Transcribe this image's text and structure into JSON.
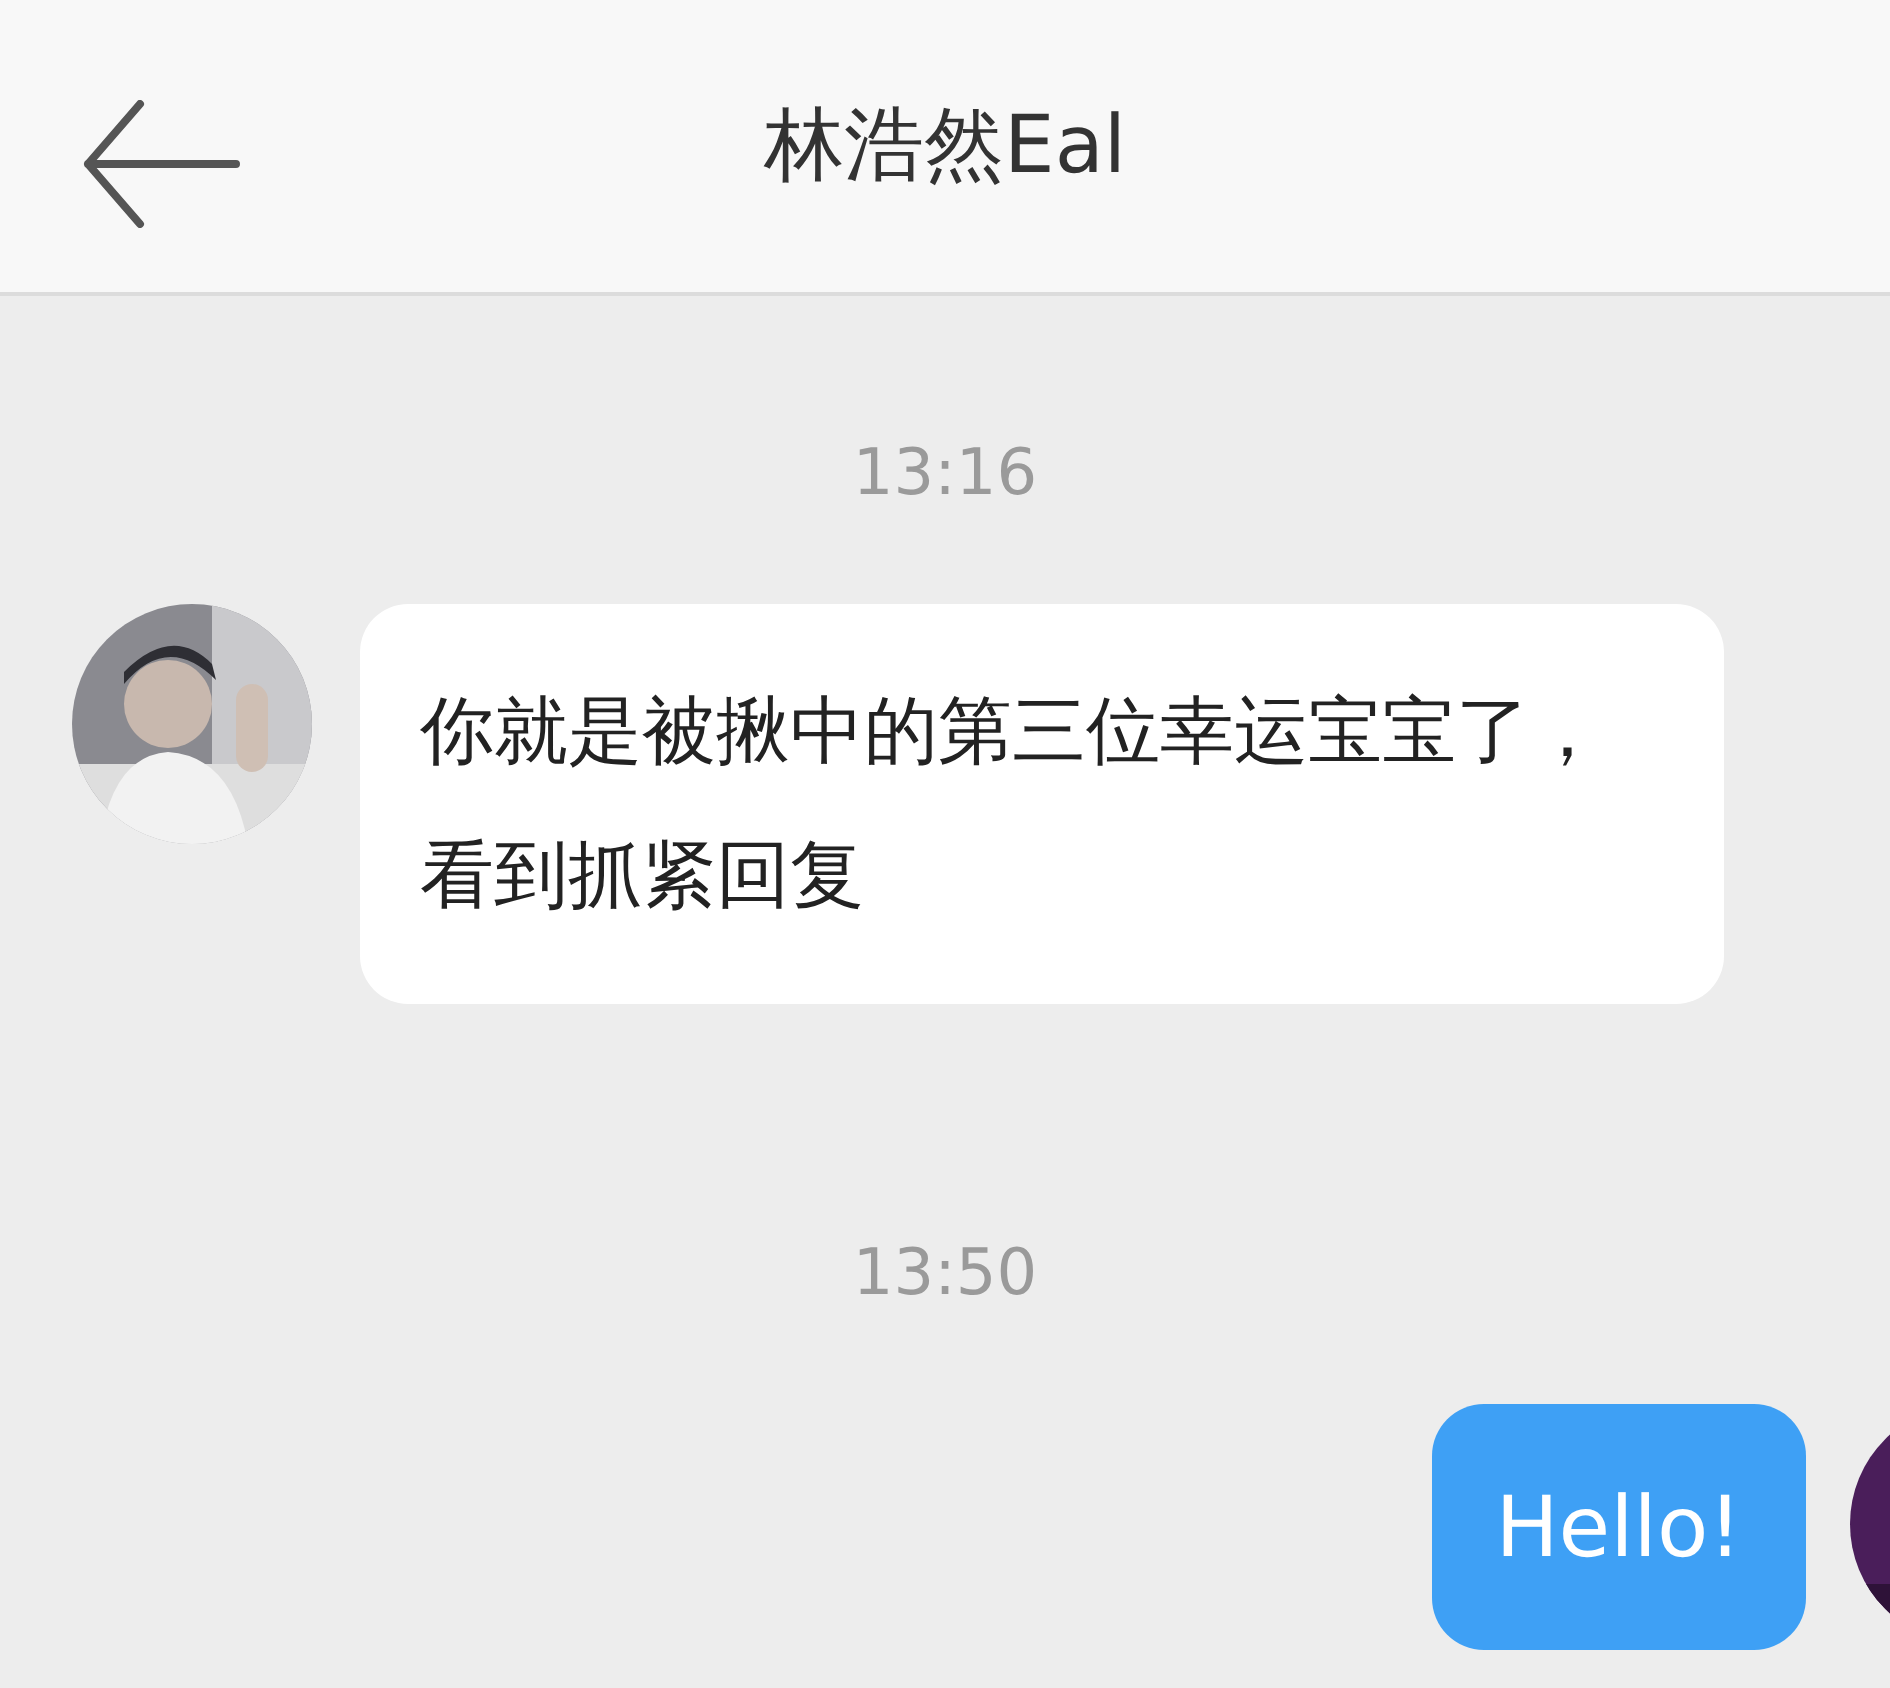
{
  "header": {
    "title": "林浩然Eal"
  },
  "messages": [
    {
      "kind": "time",
      "text": "13:16"
    },
    {
      "kind": "incoming",
      "text": "你就是被揪中的第三位幸运宝宝了，看到抓紧回复"
    },
    {
      "kind": "time",
      "text": "13:50"
    },
    {
      "kind": "outgoing",
      "text": "Hello!"
    }
  ]
}
